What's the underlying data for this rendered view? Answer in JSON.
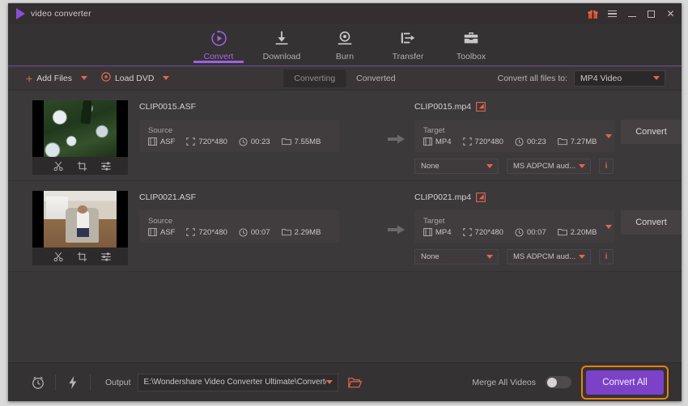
{
  "window": {
    "app_title": "video converter",
    "controls": {
      "gift": "gift-icon",
      "menu": "hamburger-menu",
      "minimize": "minimize",
      "maximize": "maximize",
      "close": "✕"
    },
    "accent_purple": "#8b4fd4",
    "accent_orange": "#e0674d",
    "highlight_orange": "#e8820c"
  },
  "nav": {
    "tabs": [
      {
        "label": "Convert",
        "icon": "convert-icon",
        "active": true
      },
      {
        "label": "Download",
        "icon": "download-icon",
        "active": false
      },
      {
        "label": "Burn",
        "icon": "burn-icon",
        "active": false
      },
      {
        "label": "Transfer",
        "icon": "transfer-icon",
        "active": false
      },
      {
        "label": "Toolbox",
        "icon": "toolbox-icon",
        "active": false
      }
    ]
  },
  "toolbar": {
    "add_files_label": "Add Files",
    "load_dvd_label": "Load DVD",
    "segments": [
      {
        "label": "Converting",
        "active": true
      },
      {
        "label": "Converted",
        "active": false
      }
    ],
    "convert_all_to_label": "Convert all files to:",
    "format_value": "MP4 Video"
  },
  "files": [
    {
      "source_name": "CLIP0015.ASF",
      "source_label": "Source",
      "source": {
        "format": "ASF",
        "resolution": "720*480",
        "duration": "00:23",
        "size": "7.55MB"
      },
      "target_name": "CLIP0015.mp4",
      "target_label": "Target",
      "target": {
        "format": "MP4",
        "resolution": "720*480",
        "duration": "00:23",
        "size": "7.27MB"
      },
      "convert_label": "Convert",
      "subtitle_value": "None",
      "audio_value": "MS ADPCM aud...",
      "info_label": "i"
    },
    {
      "source_name": "CLIP0021.ASF",
      "source_label": "Source",
      "source": {
        "format": "ASF",
        "resolution": "720*480",
        "duration": "00:07",
        "size": "2.29MB"
      },
      "target_name": "CLIP0021.mp4",
      "target_label": "Target",
      "target": {
        "format": "MP4",
        "resolution": "720*480",
        "duration": "00:07",
        "size": "2.20MB"
      },
      "convert_label": "Convert",
      "subtitle_value": "None",
      "audio_value": "MS ADPCM aud...",
      "info_label": "i"
    }
  ],
  "bottom": {
    "output_label": "Output",
    "output_path": "E:\\Wondershare Video Converter Ultimate\\Converted",
    "merge_label": "Merge All Videos",
    "merge_on": false,
    "convert_all_label": "Convert All"
  }
}
